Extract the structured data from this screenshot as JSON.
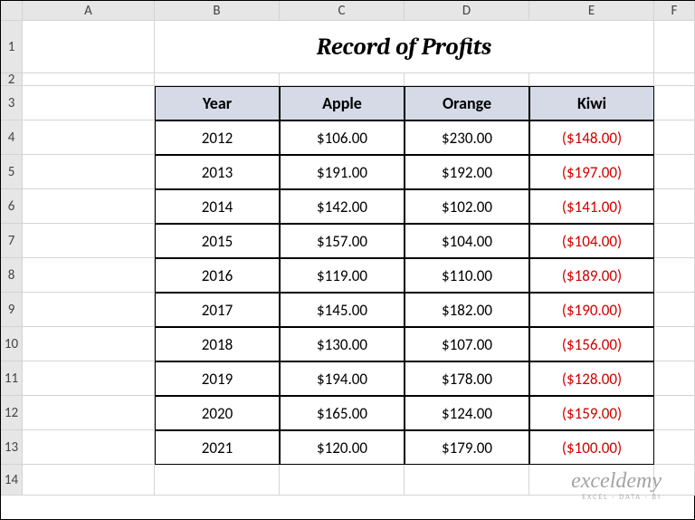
{
  "columns": [
    "",
    "A",
    "B",
    "C",
    "D",
    "E",
    "F"
  ],
  "rows": [
    "1",
    "2",
    "3",
    "4",
    "5",
    "6",
    "7",
    "8",
    "9",
    "10",
    "11",
    "12",
    "13",
    "14"
  ],
  "title": "Record of Profits",
  "headers": [
    "Year",
    "Apple",
    "Orange",
    "Kiwi"
  ],
  "data": [
    {
      "year": "2012",
      "apple": "$106.00",
      "orange": "$230.00",
      "kiwi": "($148.00)"
    },
    {
      "year": "2013",
      "apple": "$191.00",
      "orange": "$192.00",
      "kiwi": "($197.00)"
    },
    {
      "year": "2014",
      "apple": "$142.00",
      "orange": "$102.00",
      "kiwi": "($141.00)"
    },
    {
      "year": "2015",
      "apple": "$157.00",
      "orange": "$104.00",
      "kiwi": "($104.00)"
    },
    {
      "year": "2016",
      "apple": "$119.00",
      "orange": "$110.00",
      "kiwi": "($189.00)"
    },
    {
      "year": "2017",
      "apple": "$145.00",
      "orange": "$182.00",
      "kiwi": "($190.00)"
    },
    {
      "year": "2018",
      "apple": "$130.00",
      "orange": "$107.00",
      "kiwi": "($156.00)"
    },
    {
      "year": "2019",
      "apple": "$194.00",
      "orange": "$178.00",
      "kiwi": "($128.00)"
    },
    {
      "year": "2020",
      "apple": "$165.00",
      "orange": "$124.00",
      "kiwi": "($159.00)"
    },
    {
      "year": "2021",
      "apple": "$120.00",
      "orange": "$179.00",
      "kiwi": "($100.00)"
    }
  ],
  "watermark": {
    "line1": "exceldemy",
    "line2": "EXCEL · DATA · BI"
  }
}
